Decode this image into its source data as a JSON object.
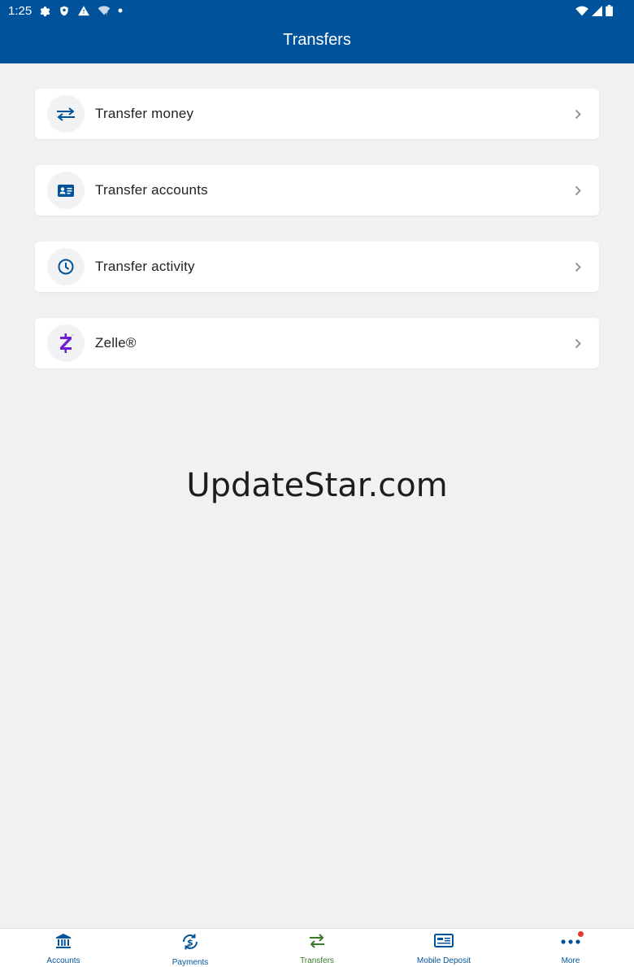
{
  "status_bar": {
    "time": "1:25",
    "left_icons": [
      "gear-icon",
      "shield-icon",
      "warning-icon",
      "wifi-question-icon",
      "dot-icon"
    ],
    "right_icons": [
      "wifi-icon",
      "signal-icon",
      "battery-icon"
    ]
  },
  "header": {
    "title": "Transfers"
  },
  "menu": {
    "items": [
      {
        "label": "Transfer money",
        "icon": "swap-arrows-icon"
      },
      {
        "label": "Transfer accounts",
        "icon": "id-card-icon"
      },
      {
        "label": "Transfer activity",
        "icon": "clock-icon"
      },
      {
        "label": "Zelle®",
        "icon": "zelle-logo-icon"
      }
    ]
  },
  "watermark": "UpdateStar.com",
  "bottom_nav": {
    "items": [
      {
        "label": "Accounts",
        "icon": "bank-icon",
        "active": false
      },
      {
        "label": "Payments",
        "icon": "dollar-cycle-icon",
        "active": false
      },
      {
        "label": "Transfers",
        "icon": "swap-arrows-icon",
        "active": true
      },
      {
        "label": "Mobile Deposit",
        "icon": "check-deposit-icon",
        "active": false
      },
      {
        "label": "More",
        "icon": "more-dots-icon",
        "active": false,
        "badge": true
      }
    ]
  },
  "colors": {
    "brand_blue": "#00539b",
    "background": "#f1f1f1",
    "active_green": "#3a7a2a",
    "zelle_purple": "#6d1ed4",
    "badge_red": "#e53935"
  }
}
